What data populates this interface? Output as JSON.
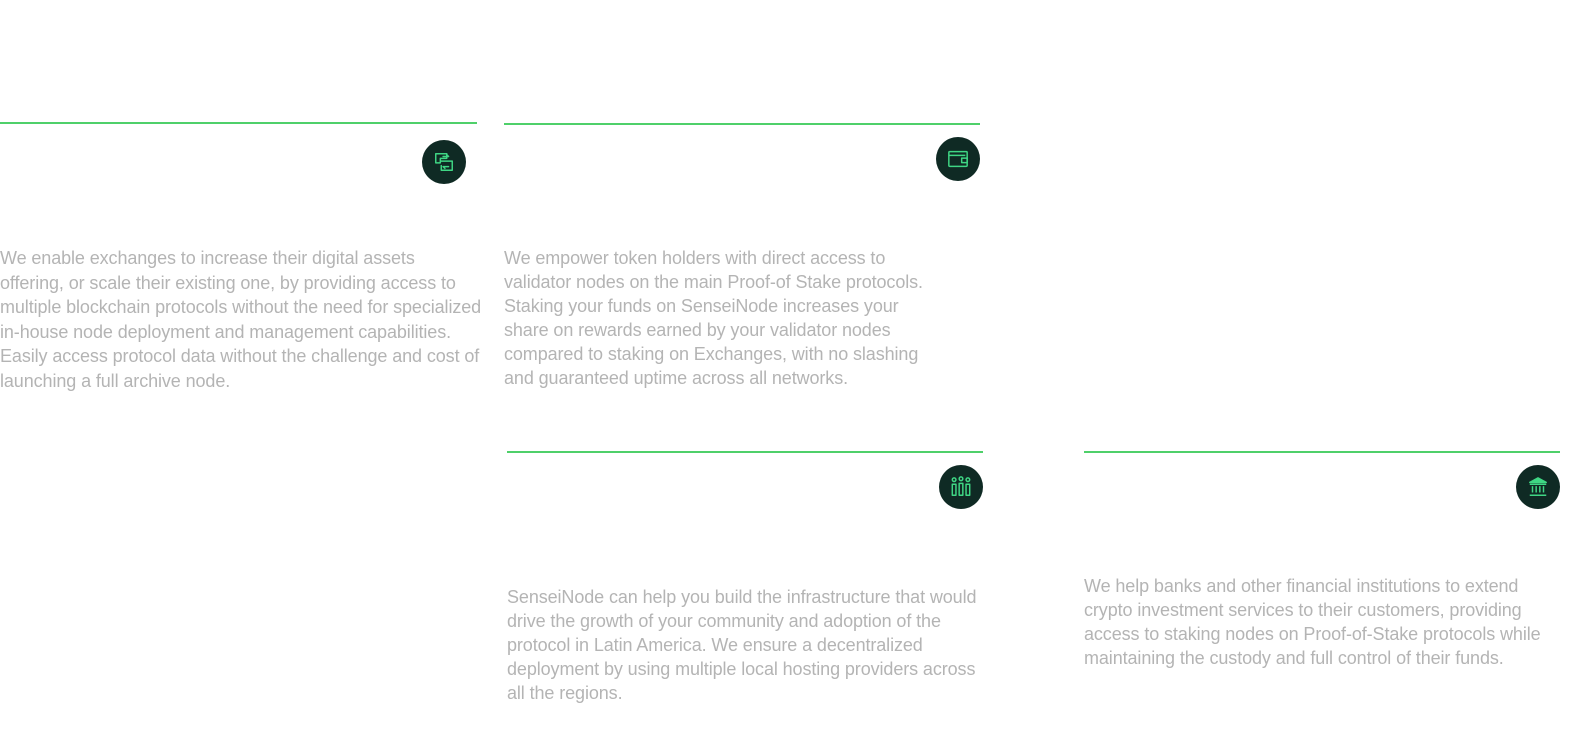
{
  "colors": {
    "accent_rule": "#4fd06a",
    "badge_background": "#0f2a24",
    "icon_stroke": "#3fd684",
    "body_text": "#b4b4b4"
  },
  "cards": [
    {
      "icon": "exchange-icon",
      "description": "We enable exchanges to increase their digital assets offering, or scale their existing one, by providing access to multiple blockchain protocols without the need for specialized in-house node deployment and management capabilities. Easily access protocol data without the challenge and cost of launching a full archive node."
    },
    {
      "icon": "wallet-icon",
      "description": "We empower token holders with direct access to validator nodes on the main Proof-of Stake protocols. Staking your funds on SenseiNode increases your share on rewards earned by your validator nodes compared to staking on Exchanges, with no slashing and guaranteed uptime across all networks."
    },
    {
      "icon": "community-icon",
      "description": "SenseiNode can help you build the infrastructure that would drive the growth of your community and adoption of the protocol in Latin America. We ensure a decentralized deployment by using multiple local hosting providers across all the regions."
    },
    {
      "icon": "bank-icon",
      "description": "We help banks and other financial institutions to extend crypto investment services to their customers, providing access to staking nodes on Proof-of-Stake protocols while maintaining the custody and full control of their funds."
    }
  ]
}
